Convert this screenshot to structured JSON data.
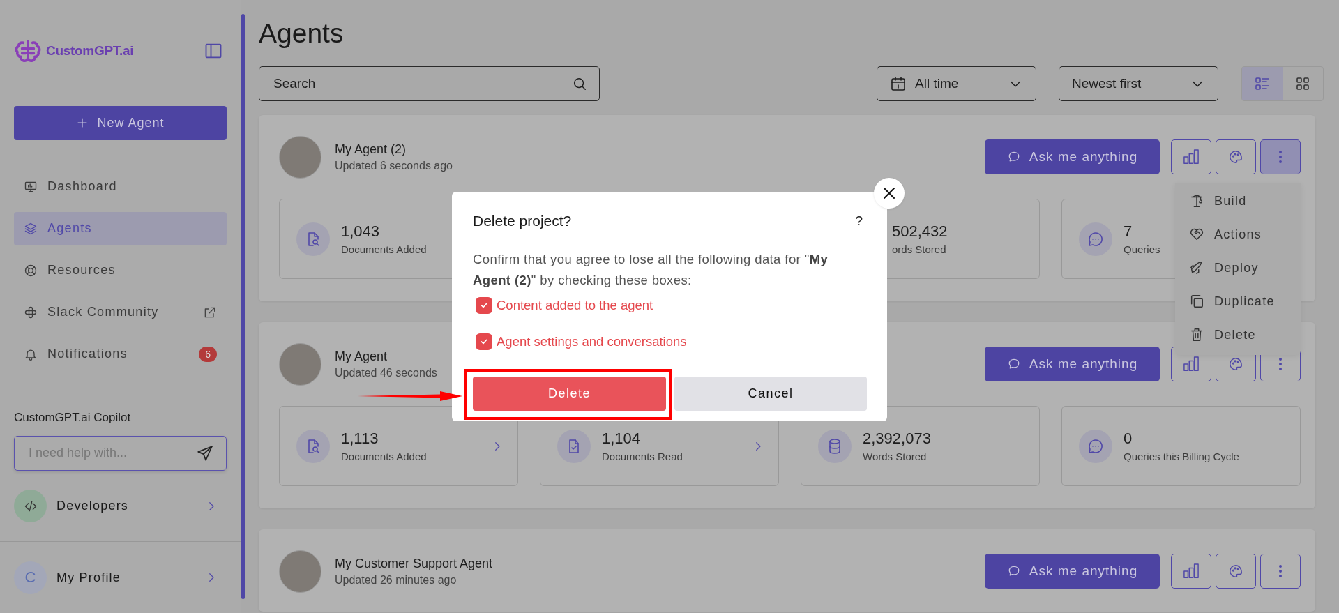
{
  "sidebar": {
    "logo": "CustomGPT.ai",
    "new_agent": "New Agent",
    "nav": [
      {
        "label": "Dashboard",
        "kind": "dashboard",
        "selected": false
      },
      {
        "label": "Agents",
        "kind": "agents",
        "selected": true
      },
      {
        "label": "Resources",
        "kind": "resources",
        "selected": false
      },
      {
        "label": "Slack Community",
        "kind": "slack",
        "selected": false,
        "external": true
      },
      {
        "label": "Notifications",
        "kind": "notifications",
        "selected": false,
        "badge": "6"
      }
    ],
    "copilot": {
      "title": "CustomGPT.ai Copilot",
      "placeholder": "I need help with..."
    },
    "developers": "Developers",
    "profile": {
      "initial": "C",
      "label": "My Profile"
    }
  },
  "main": {
    "title": "Agents",
    "search": {
      "placeholder": "Search"
    },
    "date_filter": "All time",
    "sort": "Newest first",
    "view_toggle": [
      {
        "kind": "list",
        "selected": true
      },
      {
        "kind": "grid",
        "selected": false
      }
    ],
    "agents": [
      {
        "name": "My Agent (2)",
        "updated": "Updated 6 seconds ago",
        "ask": "Ask me anything",
        "menu_open": true,
        "stats": [
          {
            "kind": "added",
            "value": "1,043",
            "label": "Documents Added",
            "covered": false
          },
          {
            "kind": "words",
            "value": "502,432",
            "label": "ords Stored",
            "covered": true
          },
          {
            "kind": "queries",
            "value": "7",
            "label": "Queries",
            "covered": false
          }
        ]
      },
      {
        "name": "My Agent",
        "updated": "Updated 46 seconds",
        "ask": "Ask me anything",
        "menu_open": false,
        "stats": [
          {
            "kind": "added",
            "value": "1,113",
            "label": "Documents Added",
            "link": true,
            "covered": false
          },
          {
            "kind": "read",
            "value": "1,104",
            "label": "Documents Read",
            "link": true,
            "covered": false
          },
          {
            "kind": "words",
            "value": "2,392,073",
            "label": "Words Stored",
            "link": false,
            "covered": false
          },
          {
            "kind": "queries",
            "value": "0",
            "label": "Queries this Billing Cycle",
            "link": false,
            "covered": false
          }
        ]
      },
      {
        "name": "My Customer Support Agent",
        "updated": "Updated 26 minutes ago",
        "ask": "Ask me anything",
        "menu_open": false
      }
    ],
    "menu": [
      {
        "kind": "build",
        "label": "Build"
      },
      {
        "kind": "actions",
        "label": "Actions"
      },
      {
        "kind": "deploy",
        "label": "Deploy"
      },
      {
        "kind": "duplicate",
        "label": "Duplicate"
      },
      {
        "kind": "delete",
        "label": "Delete"
      }
    ]
  },
  "dialog": {
    "title": "Delete project?",
    "help": "?",
    "message": "Confirm that you agree to lose all the following data for \"**My Agent (2)**\" by checking these boxes:",
    "checks": [
      {
        "label": "Content added to the agent",
        "checked": true
      },
      {
        "label": "Agent settings and conversations",
        "checked": true
      }
    ],
    "delete": {
      "label": "Delete",
      "annotated": true
    },
    "cancel": "Cancel"
  }
}
